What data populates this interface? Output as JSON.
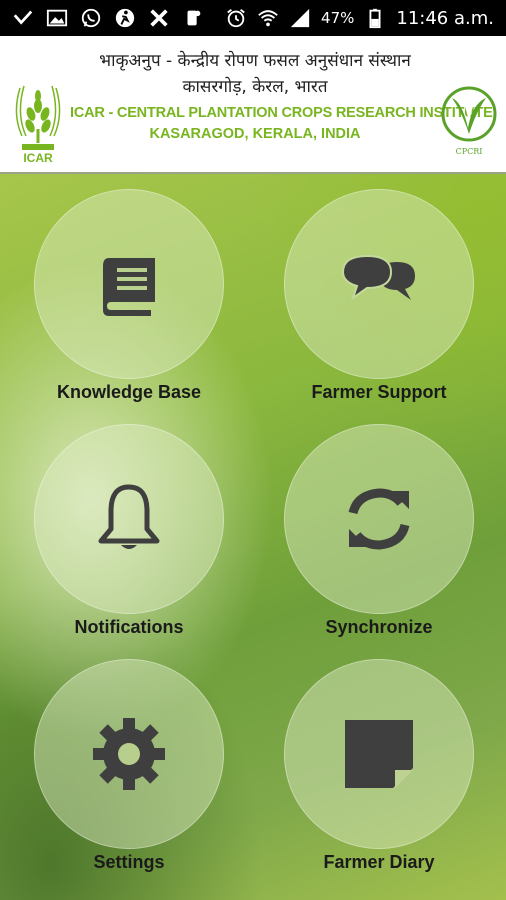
{
  "status_bar": {
    "battery_percent": "47%",
    "time": "11:46 a.m.",
    "icons": [
      "check-icon",
      "gallery-icon",
      "whatsapp-icon",
      "runner-icon",
      "tools-icon",
      "phone-settings-icon",
      "alarm-icon",
      "wifi-icon",
      "signal-icon",
      "battery-icon"
    ]
  },
  "header": {
    "hindi_line1": "भाकृअनुप - केन्द्रीय रोपण फसल अनुसंधान संस्थान",
    "hindi_line2": "कासरगोड़,  केरल, भारत",
    "english_line1": "ICAR - CENTRAL PLANTATION CROPS RESEARCH INSTITUTE",
    "english_line2": "KASARAGOD, KERALA, INDIA",
    "left_logo_text": "ICAR",
    "right_logo_text": "CPCRI",
    "brand_color": "#78b51f"
  },
  "menu": {
    "tiles": [
      {
        "label": "Knowledge Base",
        "icon": "book-icon"
      },
      {
        "label": "Farmer Support",
        "icon": "chat-bubbles-icon"
      },
      {
        "label": "Notifications",
        "icon": "bell-icon"
      },
      {
        "label": "Synchronize",
        "icon": "sync-icon"
      },
      {
        "label": "Settings",
        "icon": "gear-icon"
      },
      {
        "label": "Farmer Diary",
        "icon": "sticky-note-icon"
      }
    ]
  }
}
